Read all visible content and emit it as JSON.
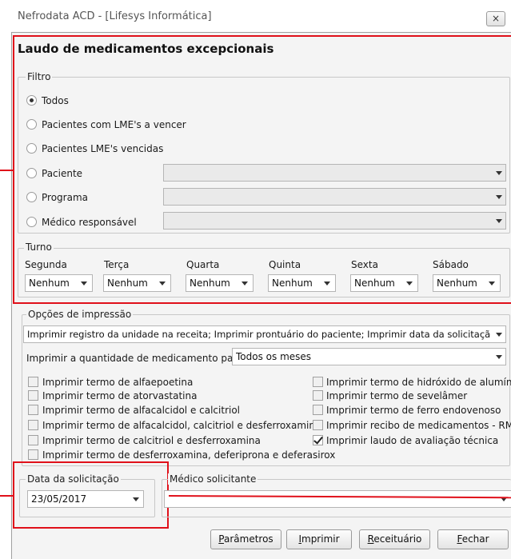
{
  "window": {
    "title": "Nefrodata ACD - [Lifesys Informática]",
    "close_glyph": "×"
  },
  "heading": "Laudo de medicamentos excepcionais",
  "filtro": {
    "legend": "Filtro",
    "options": [
      {
        "label": "Todos",
        "checked": true
      },
      {
        "label": "Pacientes com LME's a vencer",
        "checked": false
      },
      {
        "label": "Pacientes LME's vencidas",
        "checked": false
      },
      {
        "label": "Paciente",
        "checked": false
      },
      {
        "label": "Programa",
        "checked": false
      },
      {
        "label": "Médico responsável",
        "checked": false
      }
    ]
  },
  "turno": {
    "legend": "Turno",
    "days": [
      {
        "label": "Segunda",
        "value": "Nenhum"
      },
      {
        "label": "Terça",
        "value": "Nenhum"
      },
      {
        "label": "Quarta",
        "value": "Nenhum"
      },
      {
        "label": "Quinta",
        "value": "Nenhum"
      },
      {
        "label": "Sexta",
        "value": "Nenhum"
      },
      {
        "label": "Sábado",
        "value": "Nenhum"
      }
    ]
  },
  "impressao": {
    "legend": "Opções de impressão",
    "print_items_value": "Imprimir registro da unidade na receita; Imprimir prontuário do paciente; Imprimir data da solicitação no",
    "quantity_label": "Imprimir a quantidade de medicamento para",
    "quantity_value": "Todos os meses",
    "checks_left": [
      {
        "label": "Imprimir termo de alfaepoetina",
        "checked": false
      },
      {
        "label": "Imprimir termo de atorvastatina",
        "checked": false
      },
      {
        "label": "Imprimir termo de alfacalcidol e calcitriol",
        "checked": false
      },
      {
        "label": "Imprimir termo de alfacalcidol, calcitriol e desferroxamina",
        "checked": false
      },
      {
        "label": "Imprimir termo de calcitriol e desferroxamina",
        "checked": false
      },
      {
        "label": "Imprimir termo de desferroxamina, deferiprona e deferasirox",
        "checked": false
      }
    ],
    "checks_right": [
      {
        "label": "Imprimir termo de hidróxido de alumínio",
        "checked": false
      },
      {
        "label": "Imprimir termo de sevelâmer",
        "checked": false
      },
      {
        "label": "Imprimir termo de ferro endovenoso",
        "checked": false
      },
      {
        "label": "Imprimir recibo de medicamentos - RME",
        "checked": false
      },
      {
        "label": "Imprimir laudo de avaliação técnica",
        "checked": true
      }
    ]
  },
  "data_solicitacao": {
    "legend": "Data da solicitação",
    "value": "23/05/2017"
  },
  "medico_solicitante": {
    "legend": "Médico solicitante",
    "value": ""
  },
  "buttons": [
    {
      "accel": "P",
      "rest": "arâmetros",
      "name": "parametros-button"
    },
    {
      "accel": "I",
      "rest": "mprimir",
      "name": "imprimir-button"
    },
    {
      "accel": "R",
      "rest": "eceituário",
      "name": "receituario-button"
    },
    {
      "accel": "F",
      "rest": "echar",
      "name": "fechar-button"
    }
  ],
  "colors": {
    "highlight": "#e0101a",
    "panel": "#f4f4f4"
  }
}
